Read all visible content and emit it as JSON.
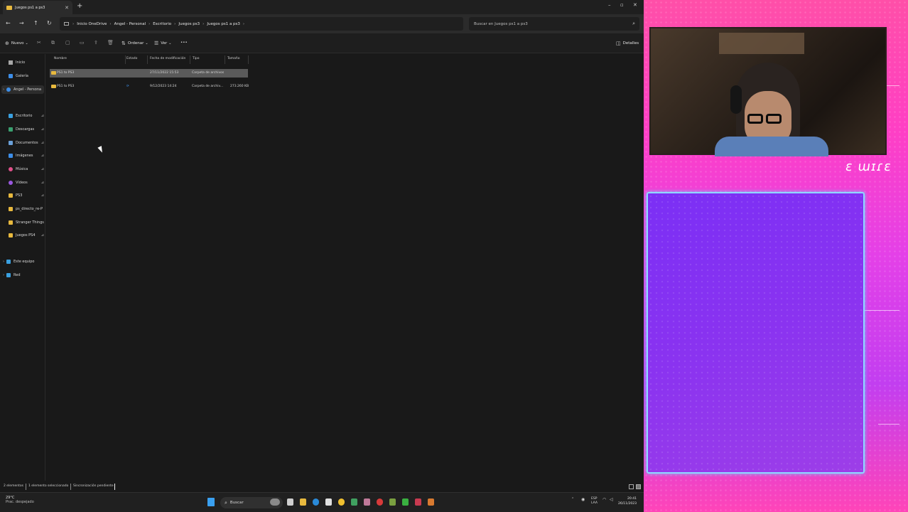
{
  "window": {
    "tab_title": "Juegos ps1 a ps3",
    "address": {
      "crumbs": [
        "Inicio OneDrive",
        "Angel - Personal",
        "Escritorio",
        "Juegos ps3",
        "Juegos ps1 a ps3"
      ]
    },
    "search_placeholder": "Buscar en Juegos ps1 a ps3"
  },
  "commandbar": {
    "new_label": "Nuevo",
    "sort_label": "Ordenar",
    "view_label": "Ver",
    "more_label": "•••",
    "details_label": "Detalles"
  },
  "sidebar": {
    "items": [
      {
        "label": "Inicio",
        "color": "#a8a8a8"
      },
      {
        "label": "Galería",
        "color": "#3d8ee8"
      },
      {
        "label": "Angel - Persona",
        "color": "#3d8ee8"
      },
      {
        "label": "Escritorio",
        "color": "#3aa0e0"
      },
      {
        "label": "Descargas",
        "color": "#3aa070"
      },
      {
        "label": "Documentos",
        "color": "#6aa0d8"
      },
      {
        "label": "Imágenes",
        "color": "#3d8ee8"
      },
      {
        "label": "Música",
        "color": "#e0508a"
      },
      {
        "label": "Vídeos",
        "color": "#9a58e0"
      },
      {
        "label": "PS3",
        "color": "#e8b93e"
      },
      {
        "label": "ps_directo_re-P",
        "color": "#e8b93e"
      },
      {
        "label": "Stranger Things P",
        "color": "#e8b93e"
      },
      {
        "label": "Juegos PS4",
        "color": "#e8b93e"
      },
      {
        "label": "Este equipo",
        "color": "#3aa0e0"
      },
      {
        "label": "Red",
        "color": "#3aa0e0"
      }
    ]
  },
  "file_list": {
    "columns": [
      "Nombre",
      "Estado",
      "Fecha de modificación",
      "Tipo",
      "Tamaño"
    ],
    "rows": [
      {
        "name": "PS1 to PS3",
        "status": "",
        "date": "27/11/2022 15:53",
        "type": "Carpeta de archivos",
        "size": ""
      },
      {
        "name": "PS1 to PS3",
        "status": "⟳",
        "date": "9/12/2023 14:24",
        "type": "Carpeta de archiv...",
        "size": "273.260 KB"
      }
    ]
  },
  "status": {
    "count": "2 elementos",
    "selected": "1 elemento seleccionado",
    "sync": "Sincronización pendiente"
  },
  "taskbar": {
    "weather_temp": "29°C",
    "weather_cond": "Prac. despejado",
    "search_label": "Buscar",
    "lang_top": "ESP",
    "lang_bottom": "LAA",
    "time": "20:41",
    "date": "26/11/2023"
  },
  "overlay": {
    "logo_text": "ɛ ɯɪɾɛ"
  }
}
